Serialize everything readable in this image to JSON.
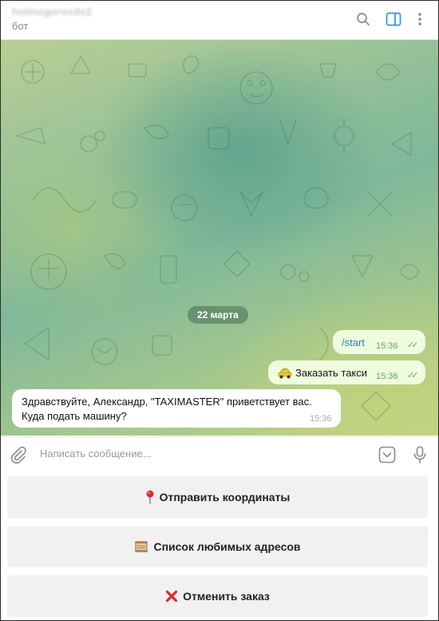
{
  "header": {
    "title": "holmogorovds2",
    "subtitle": "бот",
    "icons": [
      "search-icon",
      "sidebar-toggle-icon",
      "more-vertical-icon"
    ],
    "accent_color": "#3390ec"
  },
  "chat": {
    "date_divider": "22 марта",
    "messages": [
      {
        "direction": "out",
        "text": "/start",
        "time": "15:36",
        "status": "read"
      },
      {
        "direction": "out",
        "emoji": "taxi",
        "text": "Заказать такси",
        "time": "15:36",
        "status": "read"
      },
      {
        "direction": "in",
        "text": "Здравствуйте, Александр, \"TAXIMASTER\" приветствует вас. Куда подать машину?",
        "time": "15:36"
      }
    ]
  },
  "composer": {
    "placeholder": "Написать сообщение...",
    "icons": [
      "attach-icon",
      "keyboard-toggle-icon",
      "microphone-icon"
    ]
  },
  "keyboard": {
    "buttons": [
      {
        "emoji": "round-pushpin",
        "label": "Отправить координаты"
      },
      {
        "emoji": "scroll",
        "label": "Список любимых адресов"
      },
      {
        "emoji": "cross-mark",
        "label": "Отменить заказ"
      }
    ]
  }
}
